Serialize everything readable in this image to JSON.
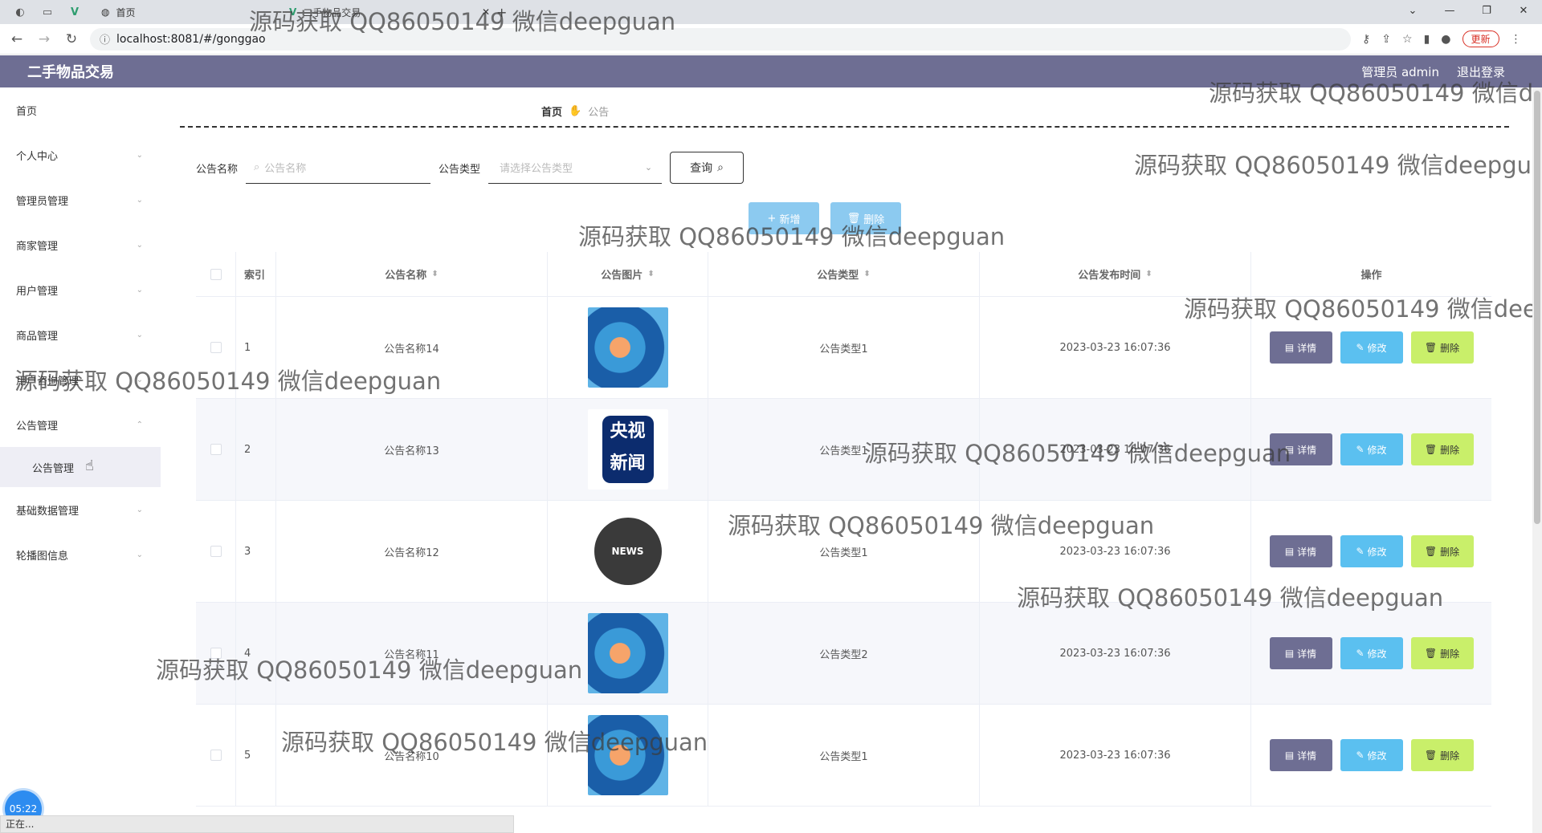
{
  "browser": {
    "tab_active_title": "首页",
    "tab2_title": "二手物品交易",
    "url": "localhost:8081/#/gonggao",
    "update_label": "更新"
  },
  "header": {
    "brand": "二手物品交易",
    "user": "管理员 admin",
    "logout": "退出登录"
  },
  "sidebar": {
    "items": [
      {
        "label": "首页"
      },
      {
        "label": "个人中心"
      },
      {
        "label": "管理员管理"
      },
      {
        "label": "商家管理"
      },
      {
        "label": "用户管理"
      },
      {
        "label": "商品管理"
      },
      {
        "label": "用户咨询管理"
      },
      {
        "label": "公告管理"
      },
      {
        "label": "基础数据管理"
      },
      {
        "label": "轮播图信息"
      }
    ],
    "sub_item": "公告管理"
  },
  "breadcrumb": {
    "home": "首页",
    "current": "公告"
  },
  "search": {
    "name_label": "公告名称",
    "name_placeholder": "公告名称",
    "type_label": "公告类型",
    "type_placeholder": "请选择公告类型",
    "query_label": "查询"
  },
  "actions": {
    "add": "新增",
    "delete": "删除"
  },
  "table": {
    "headers": [
      "索引",
      "公告名称",
      "公告图片",
      "公告类型",
      "公告发布时间",
      "操作"
    ],
    "rows": [
      {
        "idx": "1",
        "name": "公告名称14",
        "type": "公告类型1",
        "time": "2023-03-23 16:07:36"
      },
      {
        "idx": "2",
        "name": "公告名称13",
        "type": "公告类型1",
        "time": "2023-03-23 16:07:36"
      },
      {
        "idx": "3",
        "name": "公告名称12",
        "type": "公告类型1",
        "time": "2023-03-23 16:07:36"
      },
      {
        "idx": "4",
        "name": "公告名称11",
        "type": "公告类型2",
        "time": "2023-03-23 16:07:36"
      },
      {
        "idx": "5",
        "name": "公告名称10",
        "type": "公告类型1",
        "time": "2023-03-23 16:07:36"
      }
    ],
    "op_detail": "详情",
    "op_edit": "修改",
    "op_delete": "删除",
    "thumb_cctv_text": "央视新闻",
    "thumb_globe_text": "NEWS",
    "thumb_news_text": "NEWS"
  },
  "watermark": "源码获取 QQ86050149 微信deepguan",
  "timer": "05:22",
  "status": "正在..."
}
